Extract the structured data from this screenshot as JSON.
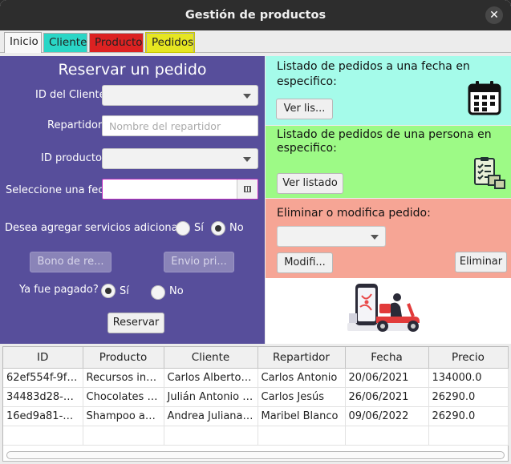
{
  "window": {
    "title": "Gestión de productos",
    "close_glyph": "✕"
  },
  "tabs": [
    {
      "label": "Inicio",
      "color": "#f8f8f8"
    },
    {
      "label": "Cliente",
      "color": "#2ad6c6"
    },
    {
      "label": "Producto",
      "color": "#dc2222"
    },
    {
      "label": "Pedidos",
      "color": "#e6e621"
    }
  ],
  "form": {
    "heading": "Reservar un pedido",
    "cliente_label": "ID del Cliente:",
    "repartidor_label": "Repartidor:",
    "repartidor_placeholder": "Nombre del repartidor",
    "producto_label": "ID producto:",
    "fecha_label": "Seleccione una fech",
    "servicios_label": "Desea agregar servicios adicionales?",
    "servicios_si": "Sí",
    "servicios_no": "No",
    "bono_button": "Bono de re...",
    "envio_button": "Envio pri...",
    "pagado_label": "Ya fue pagado?",
    "pagado_si": "Sí",
    "pagado_no": "No",
    "reservar_button": "Reservar"
  },
  "por_fecha": {
    "text_line1": "Listado de pedidos a una fecha en",
    "text_line2": "especifico:",
    "button": "Ver lis...",
    "icon": "calendar-icon"
  },
  "por_persona": {
    "text_line1": "Listado de pedidos de una persona en",
    "text_line2": "especifico:",
    "button": "Ver listado",
    "icon": "checklist-icon"
  },
  "modificar": {
    "text": "Eliminar o modifica pedido:",
    "modificar_button": "Modifi...",
    "eliminar_button": "Eliminar"
  },
  "illustration": {
    "icon": "delivery-scooter-icon"
  },
  "table": {
    "headers": [
      "ID",
      "Producto",
      "Cliente",
      "Repartidor",
      "Fecha",
      "Precio"
    ],
    "rows": [
      [
        "62ef554f-9fc...",
        "Recursos ind...",
        "Carlos Alberto ...",
        "Carlos Antonio",
        "20/06/2021",
        "134000.0"
      ],
      [
        "34483d28-d...",
        "Chocolates p...",
        "Julián Antonio Z...",
        "Carlos Jesús",
        "26/06/2021",
        "26290.0"
      ],
      [
        "16ed9a81-a3...",
        "Shampoo ant...",
        "Andrea Juliana ...",
        "Maribel Blanco",
        "09/06/2022",
        "26290.0"
      ]
    ]
  },
  "colors": {
    "form_bg": "#574e9b",
    "cyan": "#a5fbea",
    "green": "#9dfa86",
    "salmon": "#f6a595"
  }
}
